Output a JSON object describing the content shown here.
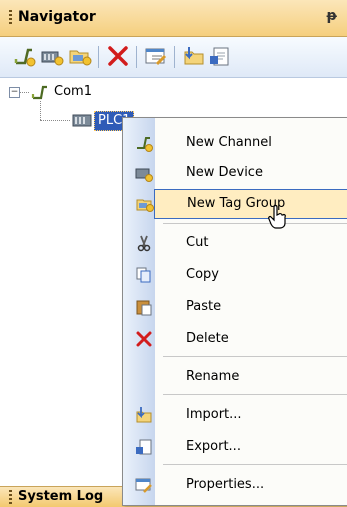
{
  "panel": {
    "title": "Navigator",
    "pin_glyph": "ᵽ"
  },
  "toolbar": {
    "icons": [
      "new-channel-icon",
      "new-device-icon",
      "new-tag-group-icon",
      "delete-icon",
      "properties-icon",
      "import-icon",
      "export-icon"
    ]
  },
  "tree": {
    "expander": "−",
    "channel": {
      "label": "Com1",
      "icon": "channel-icon"
    },
    "device": {
      "label": "PLC1",
      "icon": "device-icon"
    }
  },
  "context_menu": {
    "items": [
      {
        "label": "New Channel",
        "icon": "new-channel-icon"
      },
      {
        "label": "New Device",
        "icon": "new-device-icon"
      },
      {
        "label": "New Tag Group",
        "icon": "new-tag-group-icon",
        "highlighted": true
      },
      {
        "label": "Cut",
        "icon": "cut-icon"
      },
      {
        "label": "Copy",
        "icon": "copy-icon"
      },
      {
        "label": "Paste",
        "icon": "paste-icon"
      },
      {
        "label": "Delete",
        "icon": "delete-icon"
      },
      {
        "label": "Rename",
        "icon": ""
      },
      {
        "label": "Import...",
        "icon": "import-icon"
      },
      {
        "label": "Export...",
        "icon": "export-icon"
      },
      {
        "label": "Properties...",
        "icon": "properties-icon"
      }
    ]
  },
  "footer": {
    "title": "System Log"
  },
  "colors": {
    "header": "#f5cf7e",
    "selection": "#2f5bb7",
    "menu_hover": "#ffedc1",
    "delete_red": "#d21c1c"
  }
}
